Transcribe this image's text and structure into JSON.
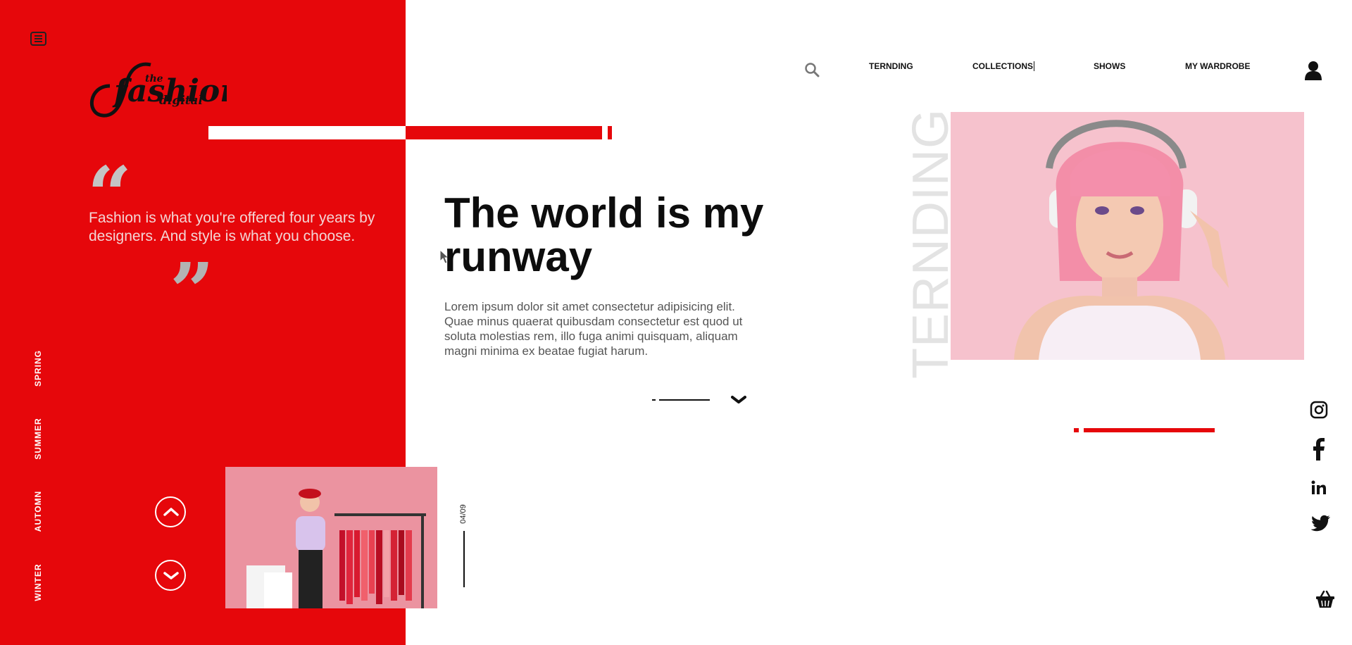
{
  "brand": {
    "logo_small": "the",
    "logo_main": "fashion",
    "logo_sub": "digital"
  },
  "colors": {
    "accent": "#e6070b",
    "background": "#ffffff",
    "muted_heading": "#e3e3e3"
  },
  "nav": {
    "items": [
      {
        "label": "TERNDING"
      },
      {
        "label": "COLLECTIONS"
      },
      {
        "label": "SHOWS"
      },
      {
        "label": "MY WARDROBE"
      }
    ],
    "search_icon": "search-icon",
    "user_icon": "user-icon",
    "menu_icon": "hamburger-menu-icon"
  },
  "quote": {
    "open_mark": "“",
    "text": "Fashion is what you're offered four years by designers. And style is what you choose.",
    "close_mark": "”"
  },
  "seasons": [
    {
      "label": "SPRING"
    },
    {
      "label": "SUMMER"
    },
    {
      "label": "AUTOMN"
    },
    {
      "label": "WINTER"
    }
  ],
  "hero": {
    "title": "The world is my runway",
    "text": "Lorem ipsum dolor sit amet consectetur adipisicing elit. Quae minus quaerat quibusdam consectetur est quod ut soluta molestias rem, illo fuga animi quisquam, aliquam magni minima ex beatae fugiat harum."
  },
  "pager": {
    "counter": "04/09"
  },
  "trending": {
    "label": "TERNDING"
  },
  "social": [
    "instagram-icon",
    "facebook-icon",
    "linkedin-icon",
    "twitter-icon"
  ],
  "cart_icon": "basket-icon"
}
